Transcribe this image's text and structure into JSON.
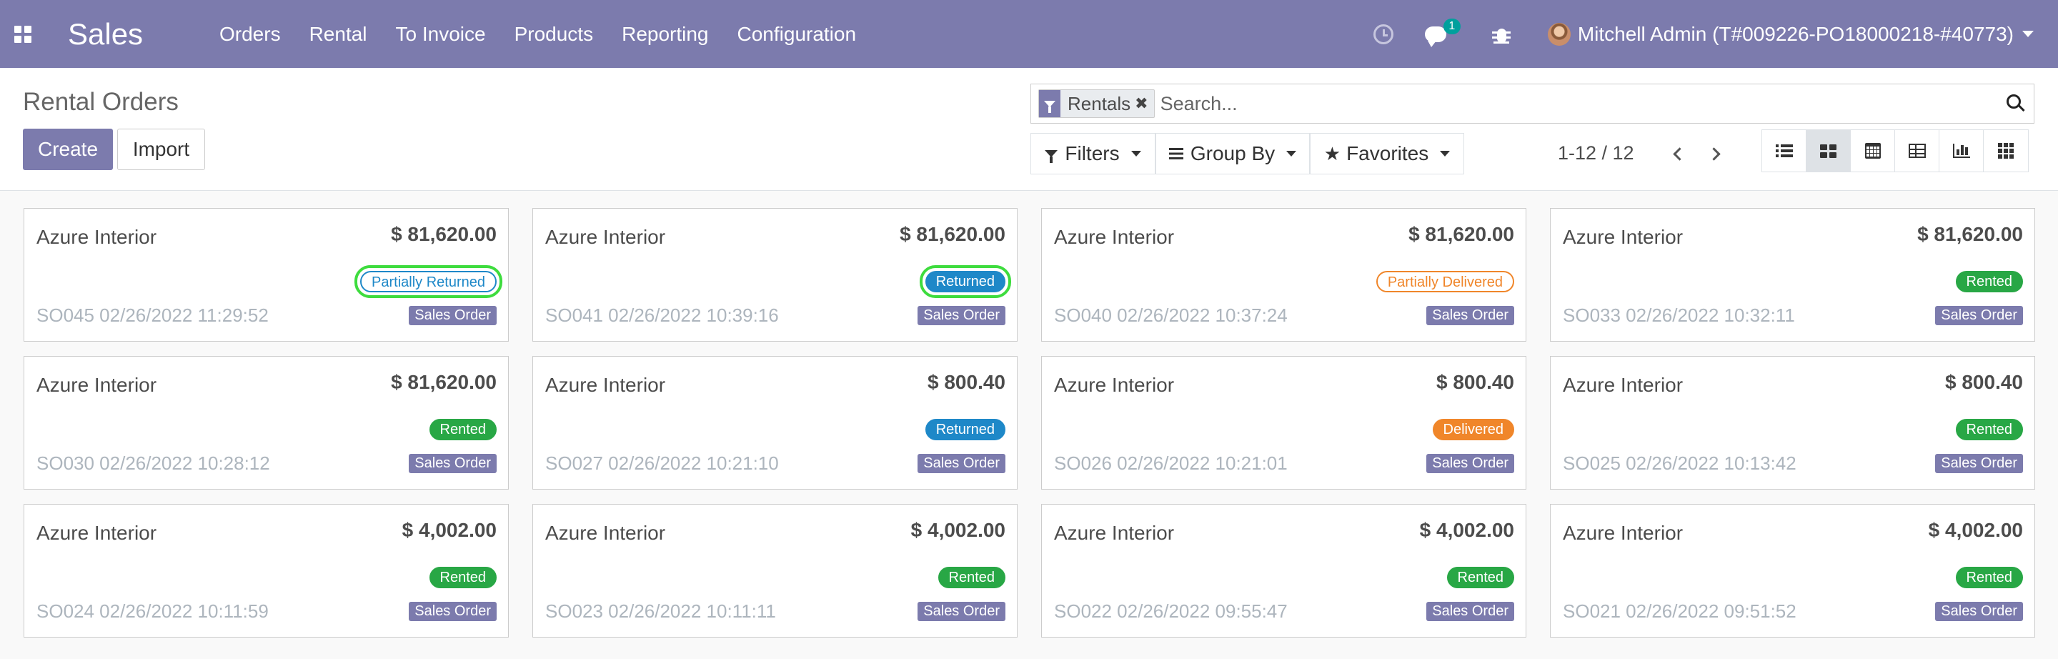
{
  "navbar": {
    "app_name": "Sales",
    "menu": [
      "Orders",
      "Rental",
      "To Invoice",
      "Products",
      "Reporting",
      "Configuration"
    ],
    "chat_count": "1",
    "user": "Mitchell Admin (T#009226-PO18000218-#40773)"
  },
  "control_panel": {
    "title": "Rental Orders",
    "create_label": "Create",
    "import_label": "Import",
    "facet_label": "Rentals",
    "facet_close": "✖",
    "search_placeholder": "Search...",
    "filters_label": "Filters",
    "group_by_label": "Group By",
    "favorites_label": "Favorites",
    "pager": "1-12 / 12"
  },
  "cards": [
    {
      "customer": "Azure Interior",
      "amount": "$ 81,620.00",
      "status": "Partially Returned",
      "status_type": "partial-ret",
      "ref": "SO045 02/26/2022 11:29:52",
      "tag": "Sales Order",
      "highlight": true
    },
    {
      "customer": "Azure Interior",
      "amount": "$ 81,620.00",
      "status": "Returned",
      "status_type": "returned",
      "ref": "SO041 02/26/2022 10:39:16",
      "tag": "Sales Order",
      "highlight": true
    },
    {
      "customer": "Azure Interior",
      "amount": "$ 81,620.00",
      "status": "Partially Delivered",
      "status_type": "partial-del",
      "ref": "SO040 02/26/2022 10:37:24",
      "tag": "Sales Order",
      "highlight": false
    },
    {
      "customer": "Azure Interior",
      "amount": "$ 81,620.00",
      "status": "Rented",
      "status_type": "rented",
      "ref": "SO033 02/26/2022 10:32:11",
      "tag": "Sales Order",
      "highlight": false
    },
    {
      "customer": "Azure Interior",
      "amount": "$ 81,620.00",
      "status": "Rented",
      "status_type": "rented",
      "ref": "SO030 02/26/2022 10:28:12",
      "tag": "Sales Order",
      "highlight": false
    },
    {
      "customer": "Azure Interior",
      "amount": "$ 800.40",
      "status": "Returned",
      "status_type": "returned",
      "ref": "SO027 02/26/2022 10:21:10",
      "tag": "Sales Order",
      "highlight": false
    },
    {
      "customer": "Azure Interior",
      "amount": "$ 800.40",
      "status": "Delivered",
      "status_type": "delivered",
      "ref": "SO026 02/26/2022 10:21:01",
      "tag": "Sales Order",
      "highlight": false
    },
    {
      "customer": "Azure Interior",
      "amount": "$ 800.40",
      "status": "Rented",
      "status_type": "rented",
      "ref": "SO025 02/26/2022 10:13:42",
      "tag": "Sales Order",
      "highlight": false
    },
    {
      "customer": "Azure Interior",
      "amount": "$ 4,002.00",
      "status": "Rented",
      "status_type": "rented",
      "ref": "SO024 02/26/2022 10:11:59",
      "tag": "Sales Order",
      "highlight": false
    },
    {
      "customer": "Azure Interior",
      "amount": "$ 4,002.00",
      "status": "Rented",
      "status_type": "rented",
      "ref": "SO023 02/26/2022 10:11:11",
      "tag": "Sales Order",
      "highlight": false
    },
    {
      "customer": "Azure Interior",
      "amount": "$ 4,002.00",
      "status": "Rented",
      "status_type": "rented",
      "ref": "SO022 02/26/2022 09:55:47",
      "tag": "Sales Order",
      "highlight": false
    },
    {
      "customer": "Azure Interior",
      "amount": "$ 4,002.00",
      "status": "Rented",
      "status_type": "rented",
      "ref": "SO021 02/26/2022 09:51:52",
      "tag": "Sales Order",
      "highlight": false
    }
  ],
  "colors": {
    "brand": "#7c7bad",
    "rented": "#28a745",
    "returned": "#1e88c8",
    "delivered": "#f0862a",
    "highlight": "#3edc3e"
  }
}
